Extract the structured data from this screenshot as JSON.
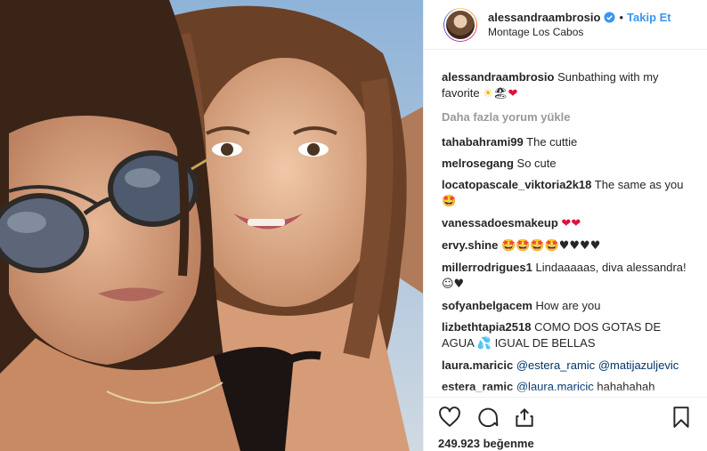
{
  "post": {
    "username": "alessandraambrosio",
    "follow_label": "Takip Et",
    "separator": "•",
    "location": "Montage Los Cabos",
    "caption": {
      "user": "alessandraambrosio",
      "text": "Sunbathing with my favorite"
    },
    "load_more_label": "Daha fazla yorum yükle",
    "comments": [
      {
        "user": "tahabahrami99",
        "text": "The cuttie"
      },
      {
        "user": "melrosegang",
        "text": "So cute"
      },
      {
        "user": "locatopascale_viktoria2k18",
        "text": "The same as you"
      },
      {
        "user": "vanessadoesmakeup",
        "text": ""
      },
      {
        "user": "ervy.shine",
        "text": ""
      },
      {
        "user": "millerrodrigues1",
        "text": "Lindaaaaas, diva alessandra!"
      },
      {
        "user": "sofyanbelgacem",
        "text": "How are you"
      },
      {
        "user": "lizbethtapia2518",
        "text": "COMO DOS GOTAS DE AGUA",
        "text2": "IGUAL DE BELLAS"
      },
      {
        "user": "laura.maricic",
        "mention1": "@estera_ramic",
        "mention2": "@matijazuljevic"
      },
      {
        "user": "estera_ramic",
        "mention1": "@laura.maricic",
        "text": "hahahahah"
      }
    ],
    "likes_label": "249.923 beğenme",
    "icons": {
      "like": "heart-outline-icon",
      "comment": "comment-bubble-icon",
      "share": "share-icon",
      "save": "bookmark-icon",
      "verified": "verified-badge-icon"
    },
    "colors": {
      "link": "#3897f0",
      "mention": "#003569",
      "muted": "#999999",
      "text": "#262626"
    }
  }
}
